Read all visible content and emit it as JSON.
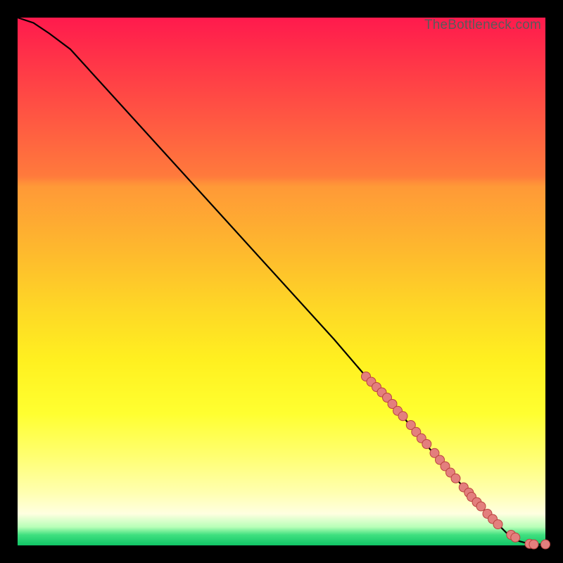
{
  "watermark": "TheBottleneck.com",
  "chart_data": {
    "type": "line",
    "title": "",
    "xlabel": "",
    "ylabel": "",
    "xlim": [
      0,
      100
    ],
    "ylim": [
      0,
      100
    ],
    "series": [
      {
        "name": "curve",
        "x": [
          0,
          3,
          6,
          10,
          20,
          30,
          40,
          50,
          60,
          66,
          70,
          75,
          80,
          85,
          90,
          93,
          95,
          97,
          99,
          100
        ],
        "y": [
          100,
          99,
          97,
          94,
          83,
          72,
          61,
          50,
          39,
          32,
          28,
          22,
          16,
          10.5,
          5,
          2,
          0.8,
          0.3,
          0.2,
          0.2
        ]
      }
    ],
    "markers": [
      {
        "name": "dots",
        "x": [
          66,
          67,
          68,
          69,
          70,
          71,
          72,
          73,
          74.5,
          75.5,
          76.5,
          77.5,
          79,
          80,
          81,
          82,
          83,
          84.5,
          85.5,
          86,
          87,
          87.8,
          89,
          90,
          91,
          93.5,
          94.3,
          97,
          97.8,
          100
        ],
        "y": [
          32,
          31,
          30,
          29,
          28,
          26.8,
          25.5,
          24.5,
          22.8,
          21.5,
          20.3,
          19.2,
          17.5,
          16.2,
          15,
          13.8,
          12.7,
          11,
          10,
          9.2,
          8.2,
          7.4,
          6,
          5,
          4,
          2,
          1.5,
          0.3,
          0.2,
          0.2
        ]
      }
    ],
    "colors": {
      "curve": "#000000",
      "marker_fill": "#e37f7d",
      "marker_stroke": "#bb433f"
    }
  }
}
